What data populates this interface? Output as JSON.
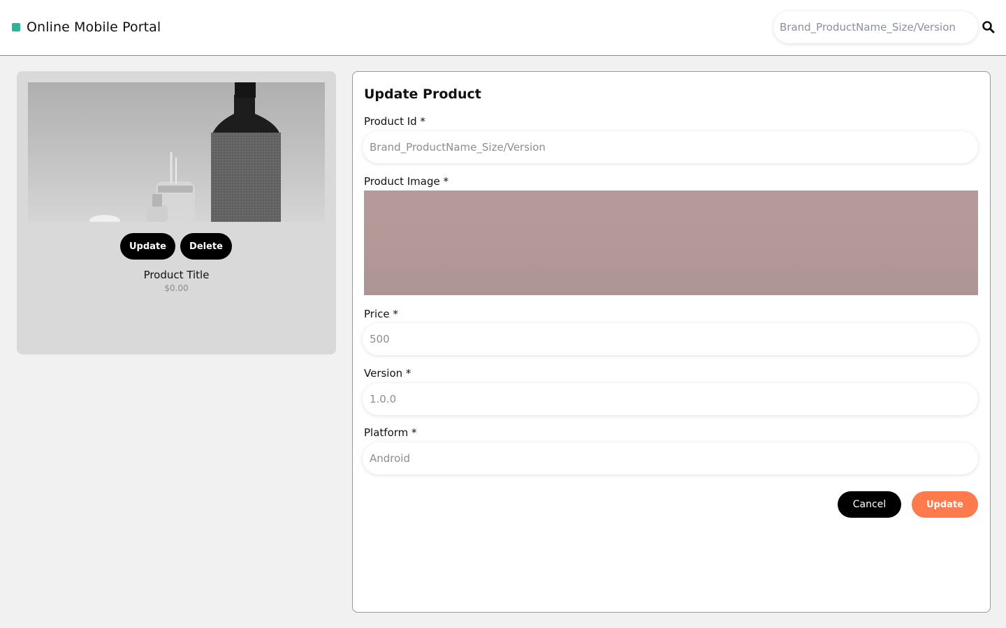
{
  "header": {
    "title": "Online Mobile Portal",
    "brand_color": "#2bb596",
    "search_placeholder": "Brand_ProductName_Size/Version",
    "search_icon": "search-icon"
  },
  "product_card": {
    "image_alt": "product-image",
    "update_label": "Update",
    "delete_label": "Delete",
    "title": "Product Title",
    "price": "$0.00"
  },
  "form": {
    "heading": "Update Product",
    "product_id": {
      "label": "Product Id *",
      "placeholder": "Brand_ProductName_Size/Version"
    },
    "product_image": {
      "label": "Product Image *"
    },
    "price": {
      "label": "Price *",
      "placeholder": "500"
    },
    "version": {
      "label": "Version *",
      "placeholder": "1.0.0"
    },
    "platform": {
      "label": "Platform *",
      "placeholder": "Android"
    },
    "cancel_label": "Cancel",
    "update_label": "Update",
    "update_color": "#ff7a4c"
  }
}
